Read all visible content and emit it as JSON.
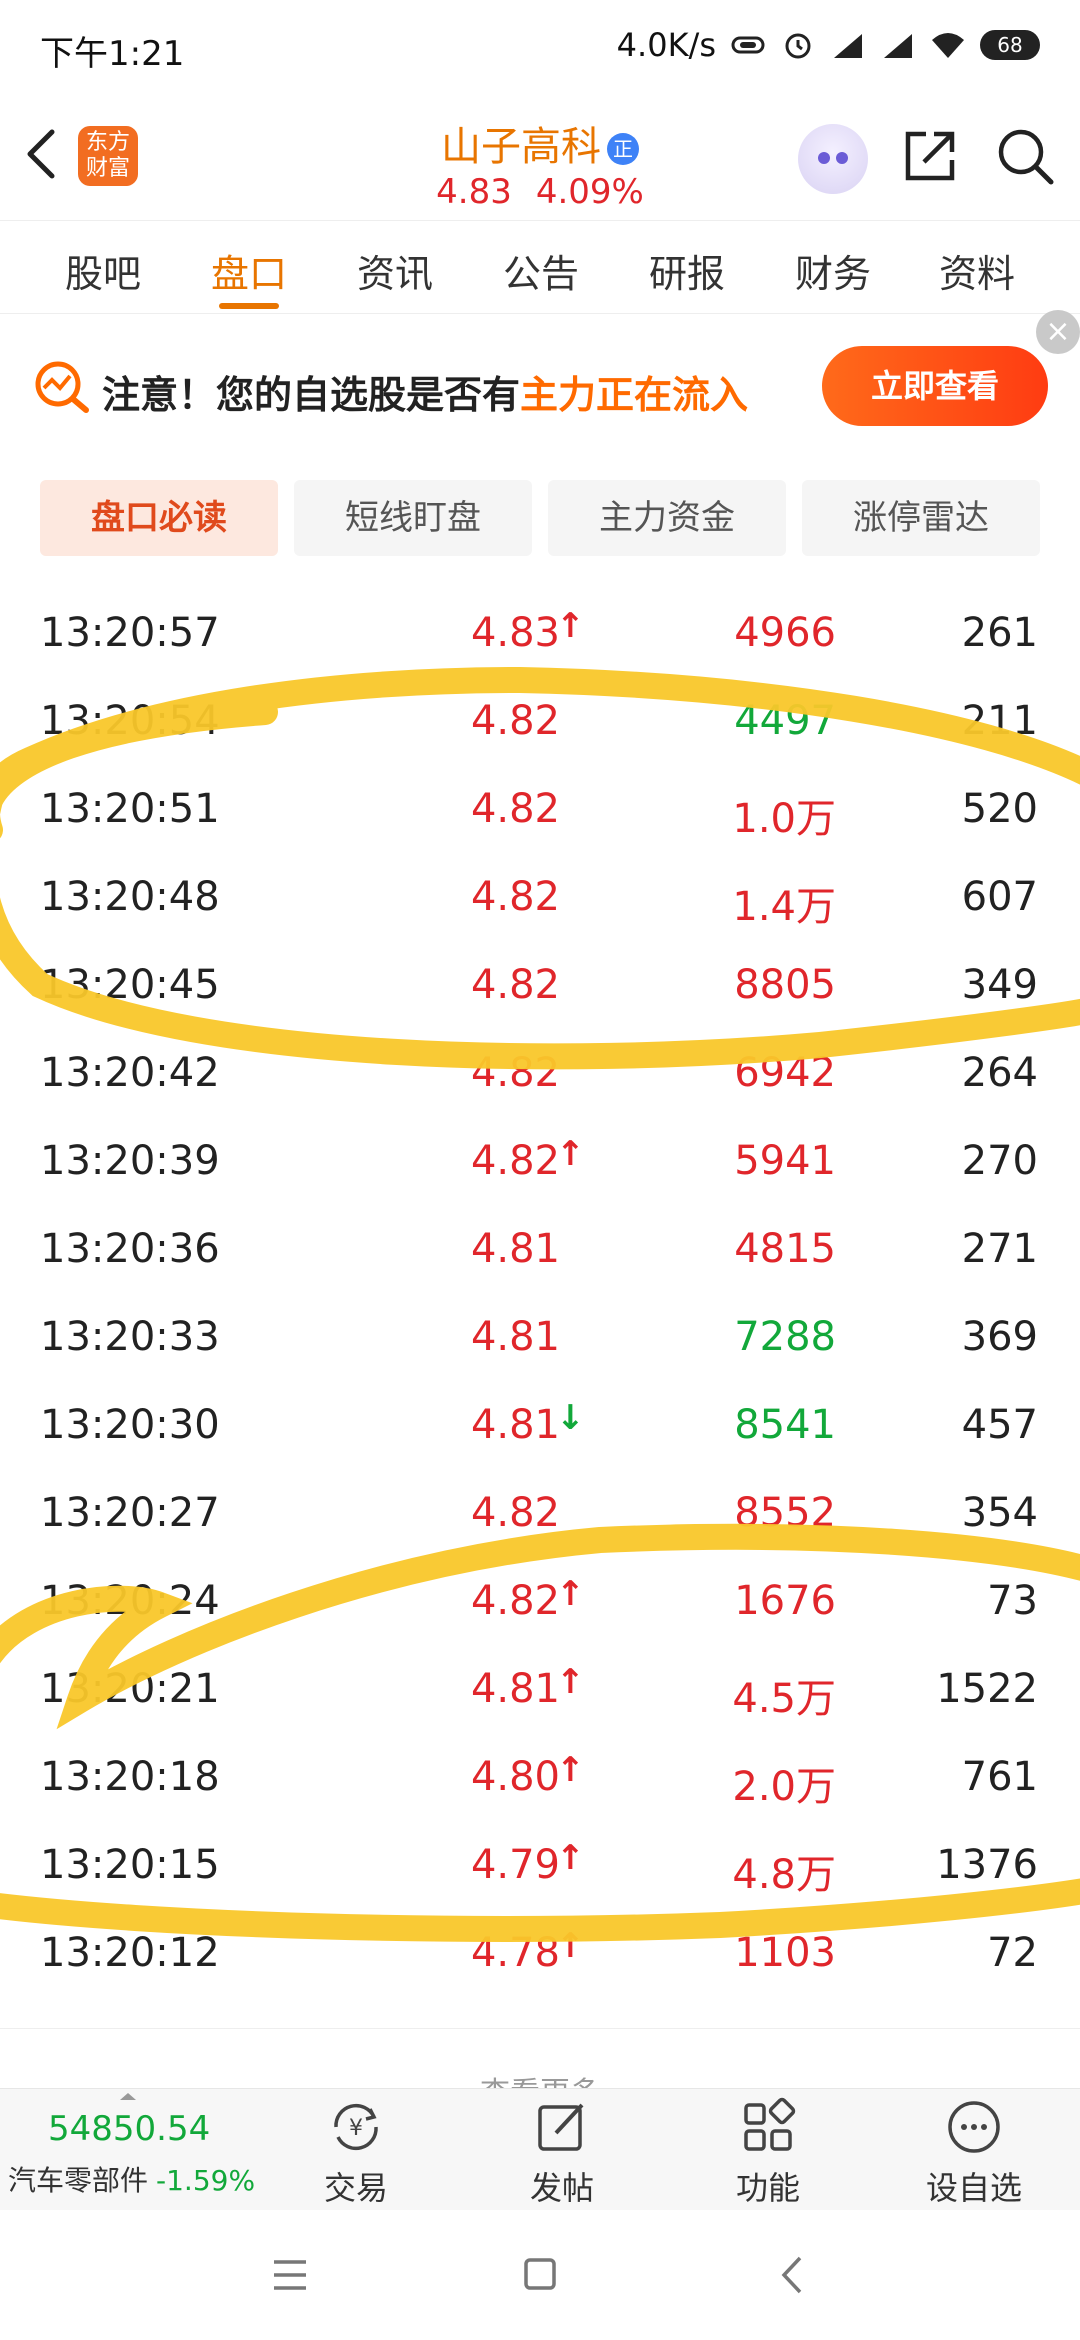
{
  "status_bar": {
    "time": "下午1:21",
    "network_speed": "4.0K/s",
    "battery": "68"
  },
  "header": {
    "logo_text": "东方财富",
    "stock_name": "山子高科",
    "badge": "正",
    "price": "4.83",
    "change_pct": "4.09%"
  },
  "tabs": [
    {
      "label": "股吧"
    },
    {
      "label": "盘口"
    },
    {
      "label": "资讯"
    },
    {
      "label": "公告"
    },
    {
      "label": "研报"
    },
    {
      "label": "财务"
    },
    {
      "label": "资料"
    }
  ],
  "active_tab": "盘口",
  "banner": {
    "text_prefix": "注意！您的自选股是否有",
    "text_highlight": "主力正在流入",
    "button": "立即查看",
    "close": "×"
  },
  "subtabs": [
    {
      "label": "盘口必读"
    },
    {
      "label": "短线盯盘"
    },
    {
      "label": "主力资金"
    },
    {
      "label": "涨停雷达"
    }
  ],
  "trades": [
    {
      "time": "13:20:57",
      "price": "4.83",
      "arrow": "↑",
      "volume": "4966",
      "count": "261",
      "vol_color": "red"
    },
    {
      "time": "13:20:54",
      "price": "4.82",
      "arrow": "",
      "volume": "4497",
      "count": "211",
      "vol_color": "green"
    },
    {
      "time": "13:20:51",
      "price": "4.82",
      "arrow": "",
      "volume": "1.0万",
      "count": "520",
      "vol_color": "red"
    },
    {
      "time": "13:20:48",
      "price": "4.82",
      "arrow": "",
      "volume": "1.4万",
      "count": "607",
      "vol_color": "red"
    },
    {
      "time": "13:20:45",
      "price": "4.82",
      "arrow": "",
      "volume": "8805",
      "count": "349",
      "vol_color": "red"
    },
    {
      "time": "13:20:42",
      "price": "4.82",
      "arrow": "",
      "volume": "6942",
      "count": "264",
      "vol_color": "red"
    },
    {
      "time": "13:20:39",
      "price": "4.82",
      "arrow": "↑",
      "volume": "5941",
      "count": "270",
      "vol_color": "red"
    },
    {
      "time": "13:20:36",
      "price": "4.81",
      "arrow": "",
      "volume": "4815",
      "count": "271",
      "vol_color": "red"
    },
    {
      "time": "13:20:33",
      "price": "4.81",
      "arrow": "",
      "volume": "7288",
      "count": "369",
      "vol_color": "green"
    },
    {
      "time": "13:20:30",
      "price": "4.81",
      "arrow": "↓",
      "volume": "8541",
      "count": "457",
      "vol_color": "green"
    },
    {
      "time": "13:20:27",
      "price": "4.82",
      "arrow": "",
      "volume": "8552",
      "count": "354",
      "vol_color": "red"
    },
    {
      "time": "13:20:24",
      "price": "4.82",
      "arrow": "↑",
      "volume": "1676",
      "count": "73",
      "vol_color": "red"
    },
    {
      "time": "13:20:21",
      "price": "4.81",
      "arrow": "↑",
      "volume": "4.5万",
      "count": "1522",
      "vol_color": "red"
    },
    {
      "time": "13:20:18",
      "price": "4.80",
      "arrow": "↑",
      "volume": "2.0万",
      "count": "761",
      "vol_color": "red"
    },
    {
      "time": "13:20:15",
      "price": "4.79",
      "arrow": "↑",
      "volume": "4.8万",
      "count": "1376",
      "vol_color": "red"
    },
    {
      "time": "13:20:12",
      "price": "4.78",
      "arrow": "↑",
      "volume": "1103",
      "count": "72",
      "vol_color": "red"
    }
  ],
  "see_more": "查看更多",
  "bottom_bar": {
    "index_value": "54850.54",
    "index_name": "汽车零部件",
    "index_change": "-1.59%",
    "items": [
      {
        "label": "交易",
        "icon": "yuan-refresh-icon"
      },
      {
        "label": "发帖",
        "icon": "edit-icon"
      },
      {
        "label": "功能",
        "icon": "grid-icon"
      },
      {
        "label": "设自选",
        "icon": "more-circle-icon"
      }
    ]
  },
  "colors": {
    "accent": "#e87500",
    "up": "#e0262b",
    "down": "#12a83a",
    "highlight_marker": "#f9c72a"
  }
}
